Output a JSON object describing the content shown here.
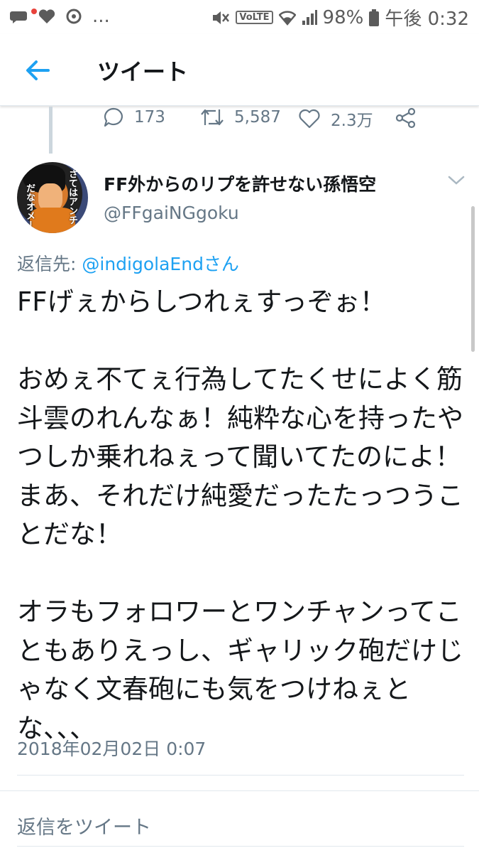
{
  "status_bar": {
    "more": "...",
    "network": "VoLTE",
    "battery": "98%",
    "time": "午後 0:32"
  },
  "header": {
    "title": "ツイート"
  },
  "parent_actions": {
    "replies": "173",
    "retweets": "5,587",
    "likes": "2.3万"
  },
  "tweet": {
    "avatar_text": [
      "さてはアンチ",
      "だなオメー"
    ],
    "display_name": "FF外からのリプを許せない孫悟空",
    "handle": "@FFgaiNGgoku",
    "reply_prefix": "返信先:",
    "reply_target": "@indigolaEndさん",
    "text": "FFげぇからしつれぇすっぞぉ！\n\nおめぇ不てぇ行為してたくせによく筋斗雲のれんなぁ！純粋な心を持ったやつしか乗れねぇって聞いてたのによ！まあ、それだけ純愛だったたっつうことだな！\n\nオラもフォロワーとワンチャンってこともありえっし、ギャリック砲だけじゃなく文春砲にも気をつけねぇとな、、、",
    "timestamp": "2018年02月02日 0:07"
  },
  "reply_box": {
    "placeholder": "返信をツイート"
  },
  "colors": {
    "accent": "#1da1f2",
    "secondary_text": "#657786",
    "primary_text": "#14171a"
  }
}
